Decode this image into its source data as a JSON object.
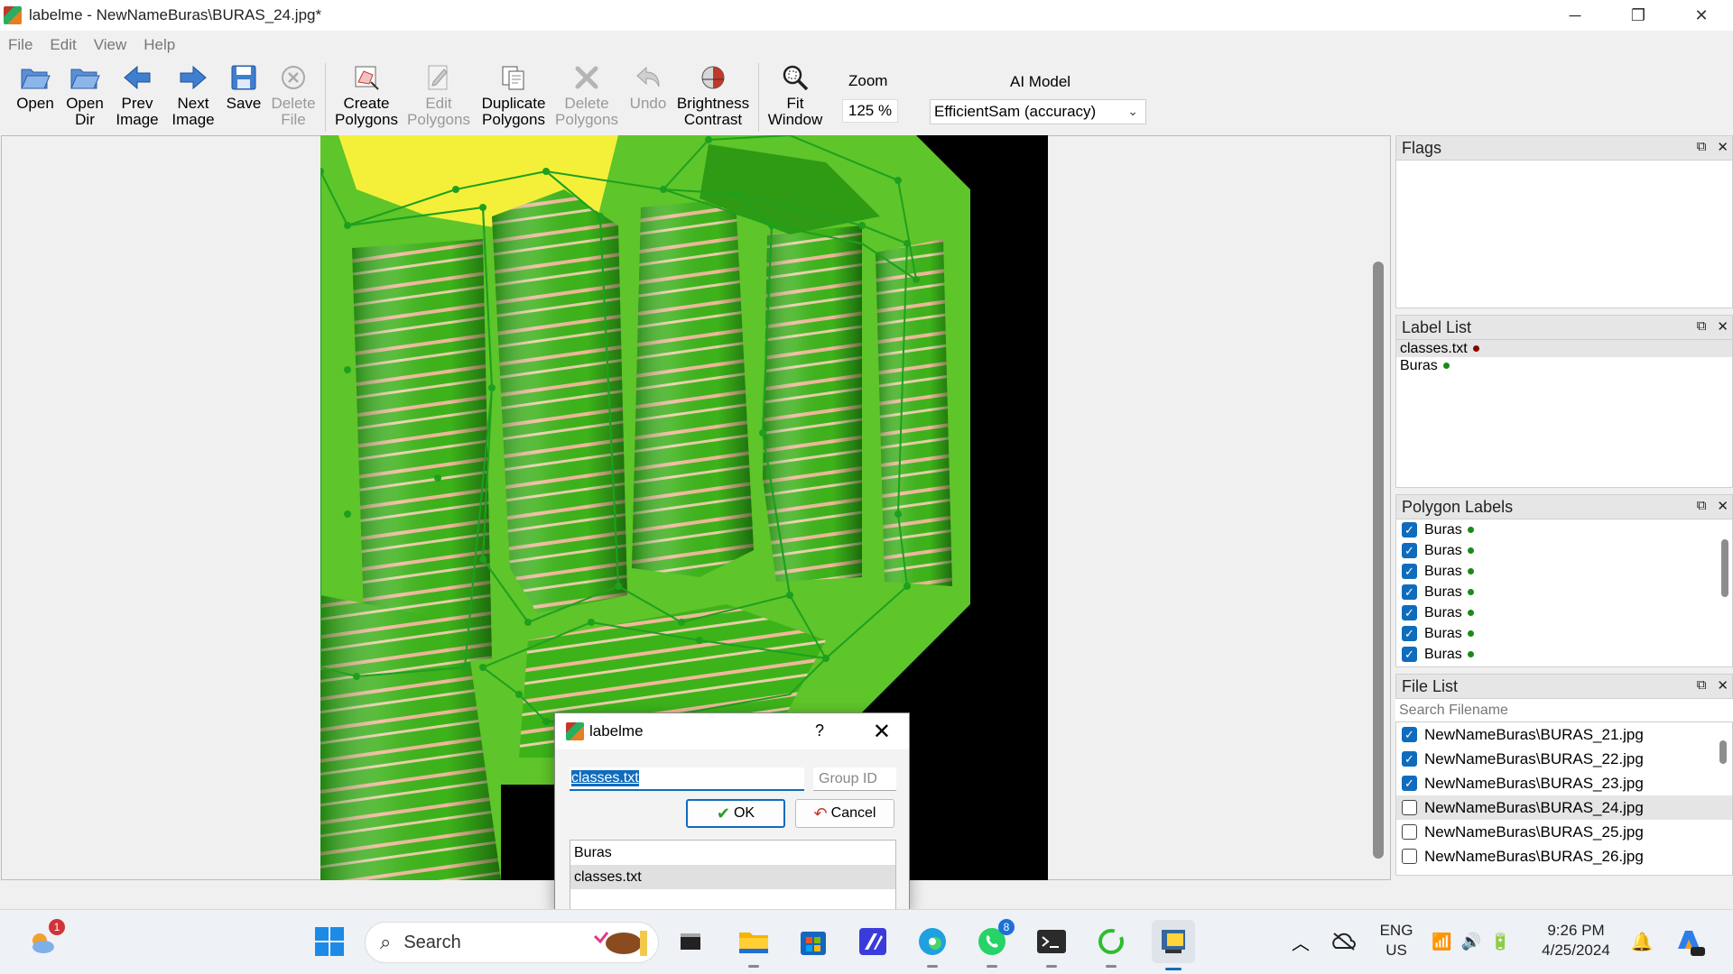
{
  "window": {
    "title": "labelme - NewNameBuras\\BURAS_24.jpg*"
  },
  "menu": [
    "File",
    "Edit",
    "View",
    "Help"
  ],
  "toolbar": {
    "open": [
      "Open",
      ""
    ],
    "open_dir": [
      "Open",
      "Dir"
    ],
    "prev_image": [
      "Prev",
      "Image"
    ],
    "next_image": [
      "Next",
      "Image"
    ],
    "save": [
      "Save",
      ""
    ],
    "delete_file": [
      "Delete",
      "File"
    ],
    "create_polygons": [
      "Create",
      "Polygons"
    ],
    "edit_polygons": [
      "Edit",
      "Polygons"
    ],
    "duplicate_polygons": [
      "Duplicate",
      "Polygons"
    ],
    "delete_polygons": [
      "Delete",
      "Polygons"
    ],
    "undo": [
      "Undo",
      ""
    ],
    "brightness_contrast": [
      "Brightness",
      "Contrast"
    ],
    "fit_window": [
      "Fit",
      "Window"
    ],
    "zoom_label": "Zoom",
    "zoom_value": "125 %",
    "ai_model_label": "AI Model",
    "ai_model_value": "EfficientSam (accuracy)"
  },
  "flags": {
    "title": "Flags"
  },
  "label_list": {
    "title": "Label List",
    "items": [
      {
        "label": "classes.txt",
        "color": "#8b0000"
      },
      {
        "label": "Buras",
        "color": "#1a8a1a"
      }
    ]
  },
  "polygon_labels": {
    "title": "Polygon Labels",
    "items": [
      "Buras",
      "Buras",
      "Buras",
      "Buras",
      "Buras",
      "Buras",
      "Buras"
    ],
    "dot_color": "#1a8a1a"
  },
  "file_list": {
    "title": "File List",
    "search_placeholder": "Search Filename",
    "items": [
      {
        "name": "NewNameBuras\\BURAS_21.jpg",
        "checked": true
      },
      {
        "name": "NewNameBuras\\BURAS_22.jpg",
        "checked": true
      },
      {
        "name": "NewNameBuras\\BURAS_23.jpg",
        "checked": true
      },
      {
        "name": "NewNameBuras\\BURAS_24.jpg",
        "checked": false
      },
      {
        "name": "NewNameBuras\\BURAS_25.jpg",
        "checked": false
      },
      {
        "name": "NewNameBuras\\BURAS_26.jpg",
        "checked": false
      }
    ]
  },
  "dialog": {
    "title": "labelme",
    "help": "?",
    "label_value": "classes.txt",
    "group_id_placeholder": "Group ID",
    "ok": "OK",
    "cancel": "Cancel",
    "list": [
      "Buras",
      "classes.txt"
    ]
  },
  "taskbar": {
    "search_placeholder": "Search",
    "weather_badge": "1",
    "whatsapp_badge": "8",
    "lang_top": "ENG",
    "lang_bottom": "US",
    "time": "9:26 PM",
    "date": "4/25/2024"
  },
  "colors": {
    "accent": "#0f6cbd",
    "polygon": "#1ea01e"
  }
}
